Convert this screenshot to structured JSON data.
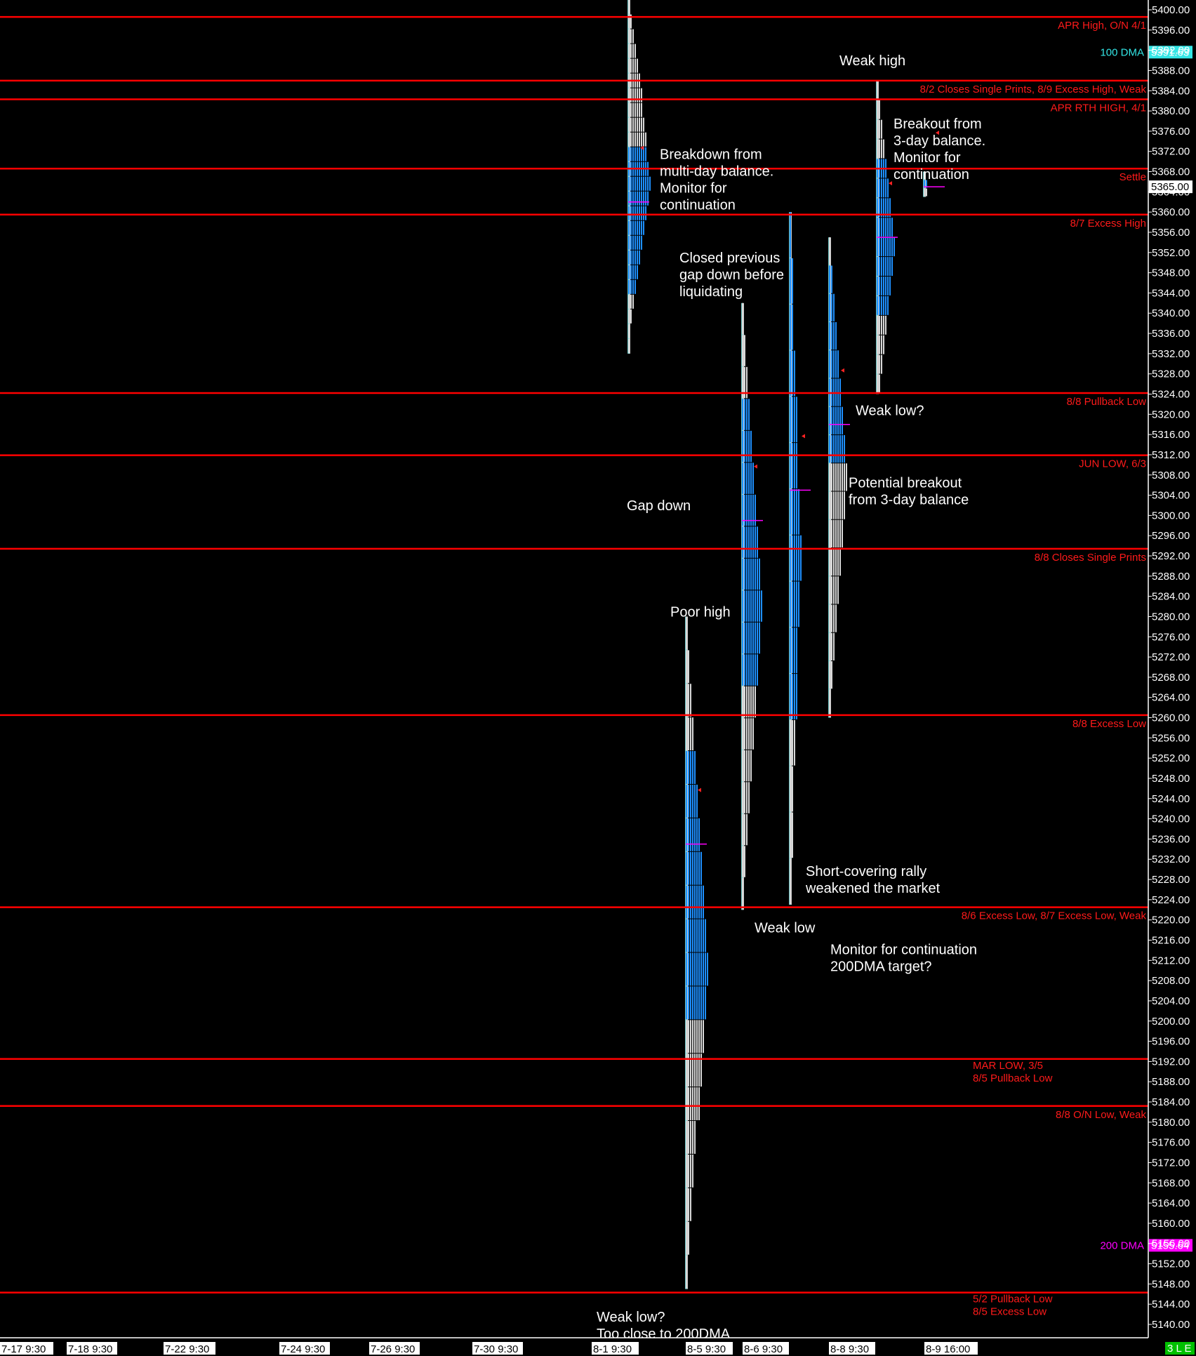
{
  "chart_data": {
    "type": "market_profile",
    "ylim": [
      5137,
      5402
    ],
    "y_tick_labels": [
      "5400.00",
      "5396.00",
      "5392.00",
      "5388.00",
      "5384.00",
      "5380.00",
      "5376.00",
      "5372.00",
      "5368.00",
      "5364.00",
      "5360.00",
      "5356.00",
      "5352.00",
      "5348.00",
      "5344.00",
      "5340.00",
      "5336.00",
      "5332.00",
      "5328.00",
      "5324.00",
      "5320.00",
      "5316.00",
      "5312.00",
      "5308.00",
      "5304.00",
      "5300.00",
      "5296.00",
      "5292.00",
      "5288.00",
      "5284.00",
      "5280.00",
      "5276.00",
      "5272.00",
      "5268.00",
      "5264.00",
      "5260.00",
      "5256.00",
      "5252.00",
      "5248.00",
      "5244.00",
      "5240.00",
      "5236.00",
      "5232.00",
      "5228.00",
      "5224.00",
      "5220.00",
      "5216.00",
      "5212.00",
      "5208.00",
      "5204.00",
      "5200.00",
      "5196.00",
      "5192.00",
      "5188.00",
      "5184.00",
      "5180.00",
      "5176.00",
      "5172.00",
      "5168.00",
      "5164.00",
      "5160.00",
      "5156.00",
      "5152.00",
      "5148.00",
      "5144.00",
      "5140.00"
    ],
    "x_tick_labels": [
      "7-17  9:30",
      "7-18  9:30",
      "7-22  9:30",
      "7-24  9:30",
      "7-26  9:30",
      "7-30  9:30",
      "8-1  9:30",
      "8-5  9:30",
      "8-6  9:30",
      "8-8  9:30",
      "8-9  16:00"
    ],
    "levels": [
      {
        "price": 5398.6,
        "label": "APR High, O/N 4/1",
        "label_side": "right"
      },
      {
        "price": 5386.0,
        "label": "8/2 Closes Single Prints, 8/9 Excess High, Weak",
        "label_side": "right"
      },
      {
        "price": 5382.3,
        "label": "APR RTH HIGH, 4/1",
        "label_side": "right"
      },
      {
        "price": 5368.6,
        "label": "Settle",
        "label_side": "right"
      },
      {
        "price": 5359.5,
        "label": "8/7 Excess High",
        "label_side": "right"
      },
      {
        "price": 5324.2,
        "label": "8/8 Pullback Low",
        "label_side": "right"
      },
      {
        "price": 5311.9,
        "label": "JUN LOW, 6/3",
        "label_side": "right"
      },
      {
        "price": 5293.4,
        "label": "8/8 Closes Single Prints",
        "label_side": "right"
      },
      {
        "price": 5260.5,
        "label": "8/8 Excess Low",
        "label_side": "right"
      },
      {
        "price": 5222.5,
        "label": "8/6 Excess Low, 8/7 Excess Low, Weak",
        "label_side": "right"
      },
      {
        "price": 5192.5,
        "label": "MAR LOW, 3/5\n8/5 Pullback Low",
        "label_side": "mid"
      },
      {
        "price": 5183.2,
        "label": "8/8 O/N Low, Weak",
        "label_side": "right"
      },
      {
        "price": 5146.3,
        "label": "5/2 Pullback Low\n8/5 Excess Low",
        "label_side": "mid"
      }
    ],
    "moving_averages": [
      {
        "name": "100 DMA",
        "value": "5391.63",
        "price": 5391.63,
        "color": "#33e6e6"
      },
      {
        "name": "200 DMA",
        "value": "5155.64",
        "price": 5155.64,
        "color": "#ff00ff"
      }
    ],
    "last_price": {
      "value": "5365.00",
      "price": 5365.0
    },
    "profiles": [
      {
        "x": 895,
        "high": 5402,
        "low": 5332,
        "poc": 5362,
        "core": [
          5345,
          5374
        ],
        "widths": [
          4,
          7,
          10,
          13,
          16,
          18,
          20,
          22,
          24,
          26,
          28,
          30,
          32,
          30,
          27,
          24,
          21,
          18,
          15,
          12,
          9,
          6,
          4,
          3
        ]
      },
      {
        "x": 977,
        "high": 5280,
        "low": 5147,
        "poc": 5235,
        "core": [
          5200,
          5252
        ],
        "widths": [
          4,
          6,
          9,
          12,
          16,
          19,
          22,
          25,
          28,
          31,
          34,
          30,
          27,
          24,
          20,
          16,
          12,
          9,
          6,
          4
        ]
      },
      {
        "x": 1057,
        "high": 5342,
        "low": 5222,
        "poc": 5299,
        "core": [
          5267,
          5322
        ],
        "widths": [
          3,
          6,
          9,
          12,
          15,
          18,
          21,
          24,
          27,
          30,
          27,
          24,
          21,
          18,
          15,
          12,
          9,
          6,
          3
        ]
      },
      {
        "x": 1125,
        "high": 5360,
        "low": 5223,
        "poc": 5305,
        "core": [
          5261,
          5358
        ],
        "widths": [
          3,
          5,
          7,
          9,
          11,
          13,
          15,
          17,
          15,
          13,
          11,
          9,
          7,
          5,
          3
        ]
      },
      {
        "x": 1181,
        "high": 5355,
        "low": 5260,
        "poc": 5318,
        "core": [
          5308,
          5347
        ],
        "widths": [
          3,
          6,
          9,
          12,
          15,
          18,
          21,
          24,
          27,
          24,
          21,
          18,
          15,
          12,
          9,
          6,
          3
        ]
      },
      {
        "x": 1249,
        "high": 5386,
        "low": 5324,
        "poc": 5355,
        "core": [
          5340,
          5370
        ],
        "widths": [
          3,
          6,
          9,
          12,
          15,
          18,
          21,
          24,
          27,
          24,
          21,
          18,
          15,
          12,
          9,
          6
        ]
      },
      {
        "x": 1316,
        "high": 5368,
        "low": 5363,
        "poc": 5365,
        "core": [
          5364,
          5367
        ],
        "widths": [
          3,
          5,
          7
        ]
      }
    ],
    "annotations": [
      {
        "text": "Weak high",
        "price": 5390.0,
        "x_anchor": 1196
      },
      {
        "text": "Breakout from\n3-day balance.\nMonitor for\ncontinuation",
        "price": 5377.5,
        "x_anchor": 1273
      },
      {
        "text": "Breakdown from\nmulti-day balance.\nMonitor for\ncontinuation",
        "price": 5371.5,
        "x_anchor": 940
      },
      {
        "text": "Closed previous\ngap down before\nliquidating",
        "price": 5351.0,
        "x_anchor": 968
      },
      {
        "text": "Weak low?",
        "price": 5320.8,
        "x_anchor": 1219
      },
      {
        "text": "Potential breakout\nfrom 3-day balance",
        "price": 5306.5,
        "x_anchor": 1209
      },
      {
        "text": "Gap down",
        "price": 5302.0,
        "x_anchor": 893
      },
      {
        "text": "Poor high",
        "price": 5281.0,
        "x_anchor": 955
      },
      {
        "text": "Short-covering rally\nweakened the market",
        "price": 5229.7,
        "x_anchor": 1148
      },
      {
        "text": "Weak low",
        "price": 5218.5,
        "x_anchor": 1075
      },
      {
        "text": "Monitor for continuation\n200DMA target?",
        "price": 5214.2,
        "x_anchor": 1183
      },
      {
        "text": "Weak low?\nToo close to 200DMA",
        "price": 5141.5,
        "x_anchor": 850
      }
    ]
  },
  "status_badge": "3 L E"
}
